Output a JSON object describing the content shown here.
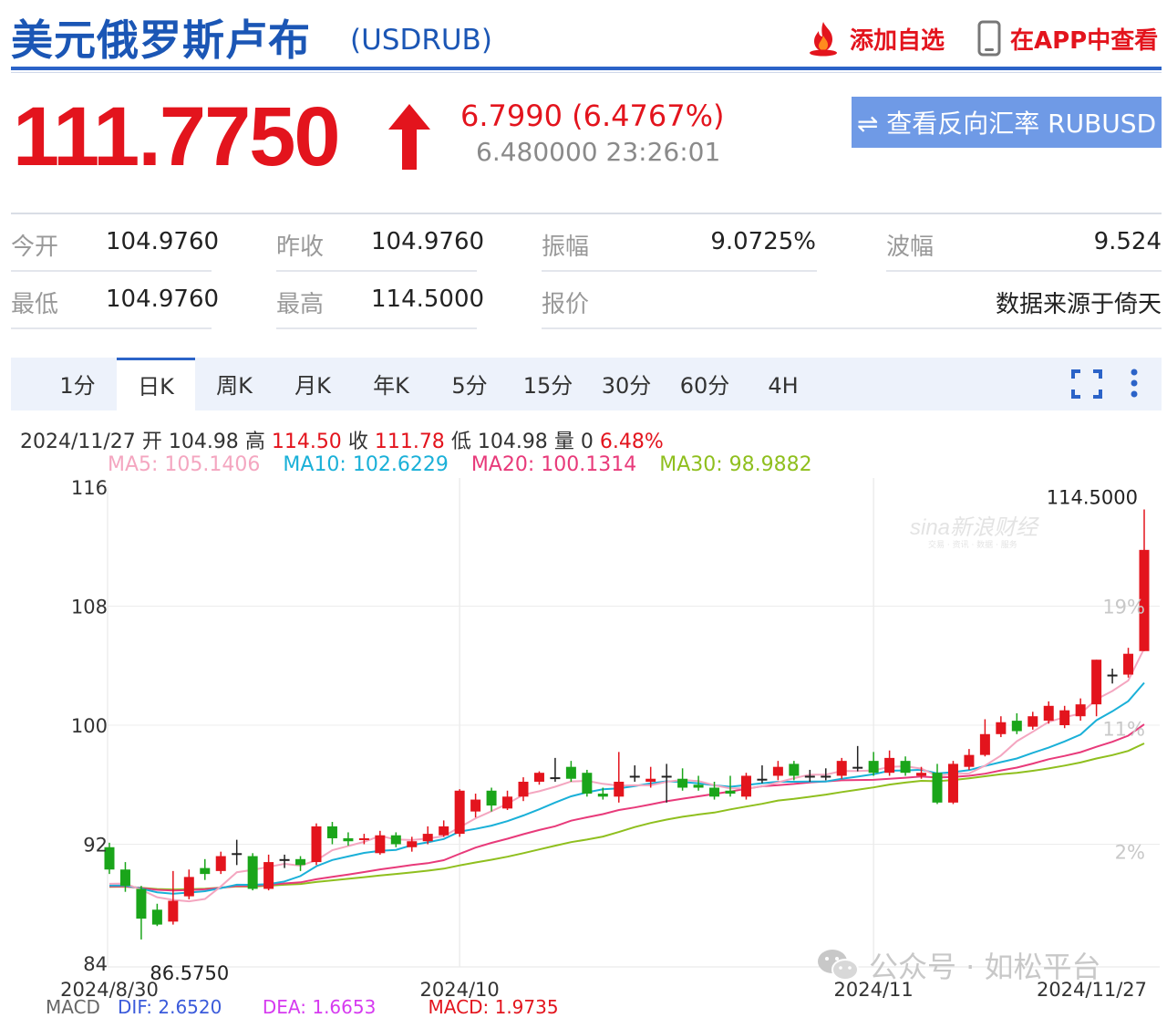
{
  "header": {
    "title": "美元俄罗斯卢布",
    "code": "(USDRUB)",
    "add_watch_label": "添加自选",
    "view_app_label": "在APP中查看"
  },
  "quote": {
    "price": "111.7750",
    "change": "6.7990 (6.4767%)",
    "pre_time": "6.480000 23:26:01",
    "reverse_button": "⇌ 查看反向汇率 RUBUSD"
  },
  "stats": [
    {
      "label": "今开",
      "value": "104.9760"
    },
    {
      "label": "昨收",
      "value": "104.9760"
    },
    {
      "label": "振幅",
      "value": "9.0725%"
    },
    {
      "label": "波幅",
      "value": "9.524"
    },
    {
      "label": "最低",
      "value": "104.9760"
    },
    {
      "label": "最高",
      "value": "114.5000"
    },
    {
      "label": "报价",
      "value": ""
    },
    {
      "label": "",
      "value": "数据来源于倚天"
    }
  ],
  "tabs": [
    "1分",
    "日K",
    "周K",
    "月K",
    "年K",
    "5分",
    "15分",
    "30分",
    "60分",
    "4H"
  ],
  "active_tab": "日K",
  "ohlc": {
    "date": "2024/11/27",
    "open_label": "开",
    "open": "104.98",
    "high_label": "高",
    "high": "114.50",
    "close_label": "收",
    "close": "111.78",
    "low_label": "低",
    "low": "104.98",
    "vol_label": "量",
    "vol": "0",
    "pct": "6.48%"
  },
  "ma": [
    {
      "text": "MA5: 105.1406",
      "color": "#f4a6c0"
    },
    {
      "text": "MA10: 102.6229",
      "color": "#1ab0d8"
    },
    {
      "text": "MA20: 100.1314",
      "color": "#e83a7a"
    },
    {
      "text": "MA30: 98.9882",
      "color": "#8fbf1e"
    }
  ],
  "watermark": {
    "sina": "sina新浪财经",
    "sina_sub": "交易 · 资讯 · 数据 · 服务",
    "wechat": "公众号 · 如松平台"
  },
  "macd": {
    "label": "MACD",
    "dif": "DIF: 2.6520",
    "dea": "DEA: 1.6653",
    "macd": "MACD: 1.9735"
  },
  "colors": {
    "up": "#e3141d",
    "down": "#1aa51a",
    "brand": "#1b56b5",
    "accent": "#2b63c8"
  },
  "chart_data": {
    "type": "candlestick",
    "y_ticks": [
      "116",
      "108",
      "100",
      "92",
      "84"
    ],
    "y_range": [
      84,
      116
    ],
    "right_ticks": [
      "19%",
      "11%",
      "2%"
    ],
    "x_ticks": [
      "2024/8/30",
      "2024/10",
      "2024/11",
      "2024/11/27"
    ],
    "max_label": "114.5000",
    "min_label": "86.5750",
    "candles": [
      {
        "o": 91.8,
        "c": 90.3,
        "h": 92.1,
        "l": 90.0
      },
      {
        "o": 90.3,
        "c": 89.2,
        "h": 90.8,
        "l": 88.8
      },
      {
        "o": 89.0,
        "c": 87.0,
        "h": 89.2,
        "l": 85.6
      },
      {
        "o": 87.6,
        "c": 86.6,
        "h": 88.0,
        "l": 86.5
      },
      {
        "o": 86.8,
        "c": 88.2,
        "h": 90.2,
        "l": 86.6
      },
      {
        "o": 88.5,
        "c": 89.8,
        "h": 90.3,
        "l": 88.3
      },
      {
        "o": 90.4,
        "c": 90.0,
        "h": 91.0,
        "l": 89.6
      },
      {
        "o": 90.2,
        "c": 91.2,
        "h": 91.5,
        "l": 90.0
      },
      {
        "o": 91.4,
        "c": 91.4,
        "h": 92.3,
        "l": 90.6
      },
      {
        "o": 91.2,
        "c": 89.0,
        "h": 91.4,
        "l": 88.9
      },
      {
        "o": 89.0,
        "c": 90.8,
        "h": 91.3,
        "l": 88.9
      },
      {
        "o": 91.0,
        "c": 91.0,
        "h": 91.3,
        "l": 90.4
      },
      {
        "o": 91.0,
        "c": 90.6,
        "h": 91.2,
        "l": 90.2
      },
      {
        "o": 90.8,
        "c": 93.2,
        "h": 93.4,
        "l": 90.6
      },
      {
        "o": 93.2,
        "c": 92.4,
        "h": 93.5,
        "l": 92.0
      },
      {
        "o": 92.4,
        "c": 92.2,
        "h": 92.8,
        "l": 91.9
      },
      {
        "o": 92.3,
        "c": 92.4,
        "h": 92.7,
        "l": 92.0
      },
      {
        "o": 91.4,
        "c": 92.6,
        "h": 92.9,
        "l": 91.3
      },
      {
        "o": 92.6,
        "c": 92.0,
        "h": 92.8,
        "l": 91.8
      },
      {
        "o": 91.8,
        "c": 92.2,
        "h": 92.5,
        "l": 91.5
      },
      {
        "o": 92.2,
        "c": 92.7,
        "h": 93.2,
        "l": 92.0
      },
      {
        "o": 92.6,
        "c": 93.2,
        "h": 93.6,
        "l": 92.5
      },
      {
        "o": 92.7,
        "c": 95.6,
        "h": 95.7,
        "l": 92.5
      },
      {
        "o": 94.2,
        "c": 95.0,
        "h": 95.4,
        "l": 93.8
      },
      {
        "o": 95.6,
        "c": 94.6,
        "h": 95.8,
        "l": 94.2
      },
      {
        "o": 94.4,
        "c": 95.2,
        "h": 95.6,
        "l": 94.3
      },
      {
        "o": 95.2,
        "c": 96.2,
        "h": 96.5,
        "l": 94.9
      },
      {
        "o": 96.2,
        "c": 96.8,
        "h": 96.9,
        "l": 96.0
      },
      {
        "o": 96.5,
        "c": 96.5,
        "h": 97.8,
        "l": 96.2
      },
      {
        "o": 97.2,
        "c": 96.4,
        "h": 97.6,
        "l": 96.2
      },
      {
        "o": 96.8,
        "c": 95.4,
        "h": 97.0,
        "l": 95.2
      },
      {
        "o": 95.4,
        "c": 95.2,
        "h": 95.8,
        "l": 95.0
      },
      {
        "o": 95.2,
        "c": 96.2,
        "h": 98.2,
        "l": 94.8
      },
      {
        "o": 96.6,
        "c": 96.6,
        "h": 97.3,
        "l": 96.2
      },
      {
        "o": 96.2,
        "c": 96.4,
        "h": 97.2,
        "l": 95.8
      },
      {
        "o": 96.6,
        "c": 96.6,
        "h": 97.4,
        "l": 94.8
      },
      {
        "o": 96.4,
        "c": 95.8,
        "h": 97.1,
        "l": 95.6
      },
      {
        "o": 96.0,
        "c": 95.8,
        "h": 96.6,
        "l": 95.6
      },
      {
        "o": 95.8,
        "c": 95.2,
        "h": 96.2,
        "l": 95.0
      },
      {
        "o": 95.6,
        "c": 95.4,
        "h": 96.6,
        "l": 95.2
      },
      {
        "o": 95.2,
        "c": 96.6,
        "h": 96.8,
        "l": 95.0
      },
      {
        "o": 96.4,
        "c": 96.4,
        "h": 97.3,
        "l": 96.1
      },
      {
        "o": 96.6,
        "c": 97.2,
        "h": 97.6,
        "l": 96.3
      },
      {
        "o": 97.4,
        "c": 96.6,
        "h": 97.6,
        "l": 96.3
      },
      {
        "o": 96.6,
        "c": 96.6,
        "h": 97.0,
        "l": 96.2
      },
      {
        "o": 96.6,
        "c": 96.6,
        "h": 97.1,
        "l": 96.3
      },
      {
        "o": 96.6,
        "c": 97.6,
        "h": 97.8,
        "l": 96.4
      },
      {
        "o": 97.2,
        "c": 97.2,
        "h": 98.6,
        "l": 96.9
      },
      {
        "o": 97.6,
        "c": 96.8,
        "h": 98.2,
        "l": 96.6
      },
      {
        "o": 96.8,
        "c": 97.8,
        "h": 98.3,
        "l": 96.6
      },
      {
        "o": 97.6,
        "c": 96.8,
        "h": 97.9,
        "l": 96.6
      },
      {
        "o": 96.6,
        "c": 96.8,
        "h": 97.2,
        "l": 96.4
      },
      {
        "o": 96.8,
        "c": 94.8,
        "h": 97.4,
        "l": 94.7
      },
      {
        "o": 94.8,
        "c": 97.4,
        "h": 97.6,
        "l": 94.7
      },
      {
        "o": 97.2,
        "c": 98.0,
        "h": 98.4,
        "l": 97.0
      },
      {
        "o": 98.0,
        "c": 99.4,
        "h": 100.4,
        "l": 97.9
      },
      {
        "o": 99.4,
        "c": 100.2,
        "h": 100.6,
        "l": 99.2
      },
      {
        "o": 100.3,
        "c": 99.6,
        "h": 100.8,
        "l": 99.4
      },
      {
        "o": 99.9,
        "c": 100.6,
        "h": 100.9,
        "l": 99.7
      },
      {
        "o": 100.3,
        "c": 101.3,
        "h": 101.6,
        "l": 100.1
      },
      {
        "o": 100.0,
        "c": 101.0,
        "h": 101.3,
        "l": 99.8
      },
      {
        "o": 100.6,
        "c": 101.4,
        "h": 101.8,
        "l": 100.3
      },
      {
        "o": 101.4,
        "c": 104.4,
        "h": 104.4,
        "l": 100.6
      },
      {
        "o": 103.4,
        "c": 103.4,
        "h": 103.8,
        "l": 102.8
      },
      {
        "o": 103.4,
        "c": 104.8,
        "h": 105.2,
        "l": 103.2
      },
      {
        "o": 104.98,
        "c": 111.78,
        "h": 114.5,
        "l": 104.98
      }
    ]
  }
}
